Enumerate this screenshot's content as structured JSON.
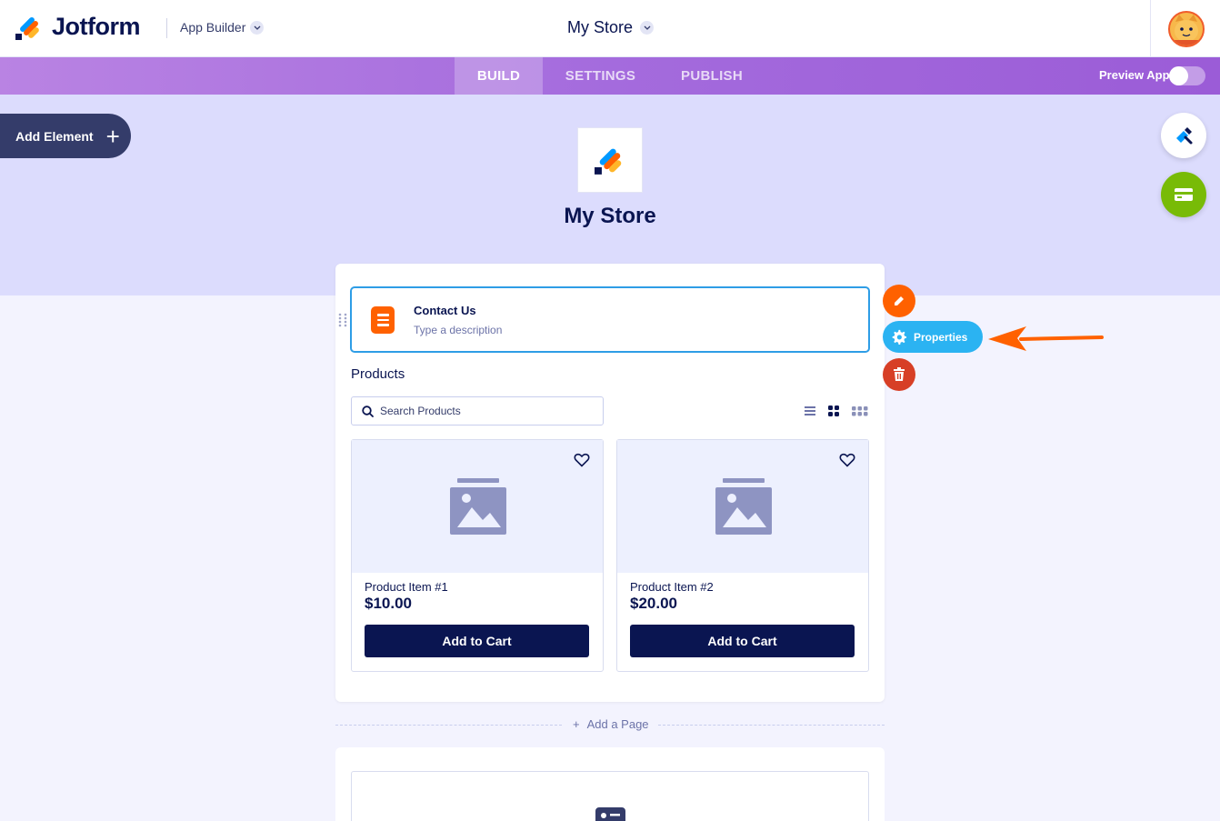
{
  "header": {
    "brand": "Jotform",
    "app_builder_label": "App Builder",
    "store_title": "My Store"
  },
  "nav": {
    "tabs": [
      {
        "label": "BUILD",
        "active": true
      },
      {
        "label": "SETTINGS",
        "active": false
      },
      {
        "label": "PUBLISH",
        "active": false
      }
    ],
    "preview_label": "Preview App",
    "preview_on": false
  },
  "builder": {
    "add_element_label": "Add Element",
    "app_name": "My Store"
  },
  "contact": {
    "title": "Contact Us",
    "description": "Type a description"
  },
  "actions": {
    "properties_label": "Properties"
  },
  "products": {
    "title": "Products",
    "search_placeholder": "Search Products",
    "items": [
      {
        "name": "Product Item #1",
        "price": "$10.00",
        "button": "Add to Cart"
      },
      {
        "name": "Product Item #2",
        "price": "$20.00",
        "button": "Add to Cart"
      }
    ]
  },
  "add_page_label": "Add a Page",
  "colors": {
    "navy": "#0a1551",
    "accent_orange": "#ff6100",
    "accent_blue": "#2bb3f2",
    "delete_red": "#d73f26",
    "green": "#78bb07",
    "hero_bg": "#dcdcfd"
  },
  "icons": [
    "jotform-logo",
    "chevron-down-icon",
    "avatar",
    "plus-icon",
    "app-logo",
    "paint-brush-icon",
    "card-icon",
    "drag-handle-icon",
    "form-icon",
    "pencil-icon",
    "gear-icon",
    "trash-icon",
    "arrow-icon",
    "search-icon",
    "list-view-icon",
    "grid-view-icon",
    "compact-grid-icon",
    "heart-icon",
    "image-placeholder-icon"
  ]
}
